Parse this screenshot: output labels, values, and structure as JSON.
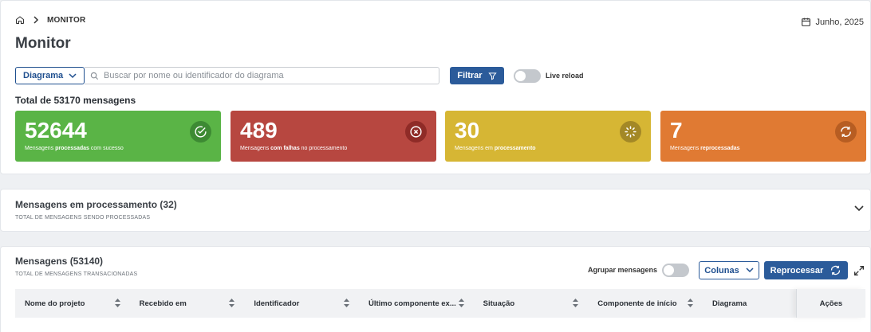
{
  "breadcrumb": {
    "current": "MONITOR"
  },
  "page_title": "Monitor",
  "date": "Junho, 2025",
  "filters": {
    "diagram_select": "Diagrama",
    "search_placeholder": "Buscar por nome ou identificador do diagrama",
    "filter_button": "Filtrar",
    "live_reload": "Live reload"
  },
  "total_label": "Total de 53170 mensagens",
  "cards": [
    {
      "value": "52644",
      "label_pre": "Mensagens ",
      "label_bold": "processadas",
      "label_post": " com sucesso",
      "icon": "check-circle-icon",
      "color": "#5ab446"
    },
    {
      "value": "489",
      "label_pre": "Mensagens ",
      "label_bold": "com falhas",
      "label_post": " no processamento",
      "icon": "x-circle-icon",
      "color": "#b74740"
    },
    {
      "value": "30",
      "label_pre": "Mensagens em ",
      "label_bold": "processamento",
      "label_post": "",
      "icon": "loader-icon",
      "color": "#d6b634"
    },
    {
      "value": "7",
      "label_pre": "Mensagens ",
      "label_bold": "reprocessadas",
      "label_post": "",
      "icon": "refresh-icon",
      "color": "#e07a33"
    }
  ],
  "processing_section": {
    "title": "Mensagens em processamento (32)",
    "subtitle": "TOTAL DE MENSAGENS SENDO PROCESSADAS"
  },
  "messages_section": {
    "title": "Mensagens (53140)",
    "subtitle": "TOTAL DE MENSAGENS TRANSACIONADAS",
    "group_label": "Agrupar mensagens",
    "columns_button": "Colunas",
    "reprocess_button": "Reprocessar"
  },
  "table": {
    "columns": [
      "Nome do projeto",
      "Recebido em",
      "Identificador",
      "Último componente ex...",
      "Situação",
      "Componente de início",
      "Diagrama",
      "Ações"
    ]
  }
}
